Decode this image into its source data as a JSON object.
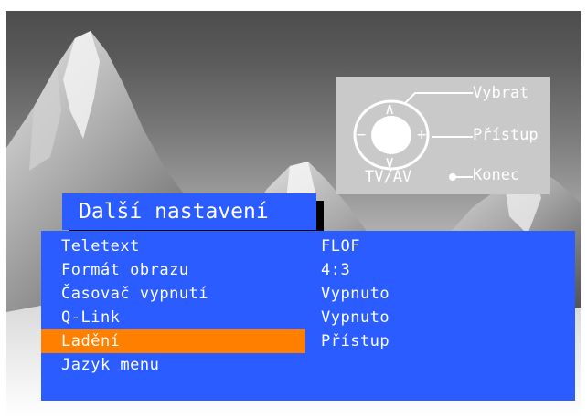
{
  "help": {
    "select": "Vybrat",
    "access": "Přístup",
    "exit": "Konec",
    "source_button": "TV/AV",
    "nav_up": "∧",
    "nav_down": "∨",
    "nav_left": "−",
    "nav_right": "+"
  },
  "menu": {
    "title": "Další nastavení",
    "selected_index": 4,
    "items": [
      {
        "label": "Teletext",
        "value": "FLOF"
      },
      {
        "label": "Formát obrazu",
        "value": "4:3"
      },
      {
        "label": "Časovač vypnutí",
        "value": "Vypnuto"
      },
      {
        "label": "Q-Link",
        "value": "Vypnuto"
      },
      {
        "label": "Ladění",
        "value": "Přístup"
      },
      {
        "label": "Jazyk menu",
        "value": ""
      }
    ]
  },
  "colors": {
    "menu_background": "#2b5cff",
    "highlight": "#ff7f00",
    "help_panel": "#c9c9c9",
    "text": "#ffffff"
  }
}
